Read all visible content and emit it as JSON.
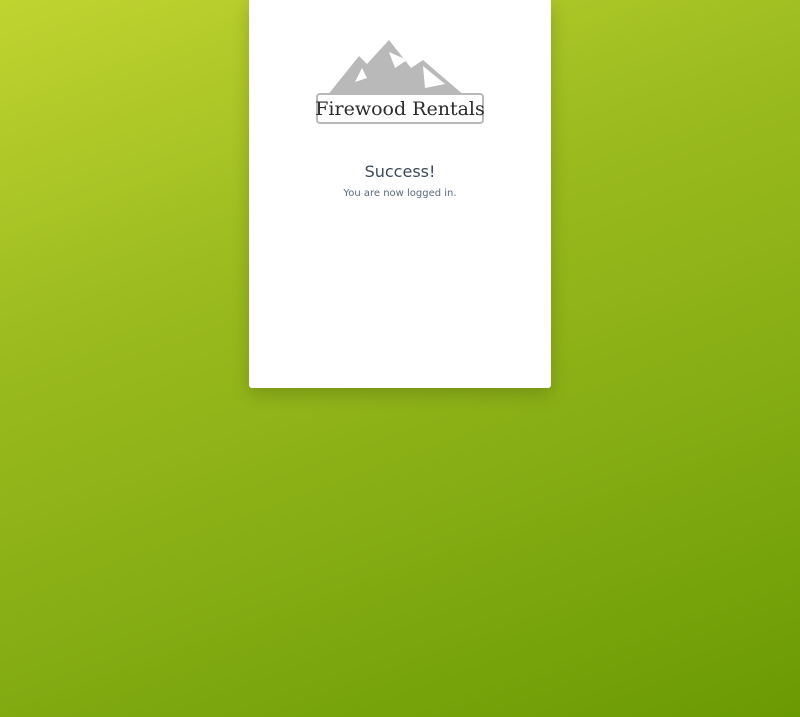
{
  "brand": {
    "name": "Firewood Rentals",
    "logo_icon": "mountain-logo-icon"
  },
  "status": {
    "title": "Success!",
    "message": "You are now logged in."
  },
  "colors": {
    "background_start": "#c0d430",
    "background_end": "#6a9a02",
    "card": "#ffffff",
    "title_text": "#3d4a5c",
    "logo_gray": "#b9b9b9"
  }
}
